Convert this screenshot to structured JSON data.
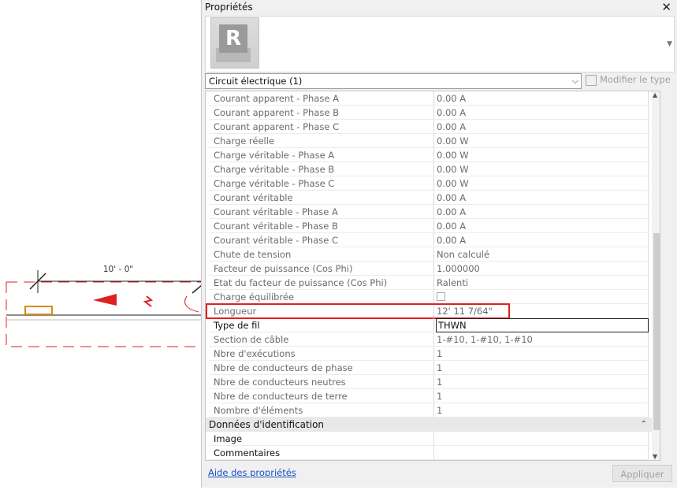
{
  "canvas": {
    "dimension_label": "10' - 0\""
  },
  "panel": {
    "title": "Propriétés",
    "close_glyph": "✕",
    "type_selector": {
      "value": "Circuit électrique (1)"
    },
    "modify_type_label": "Modifier le type",
    "rows": [
      {
        "name": "Courant apparent - Phase A",
        "value": "0.00 A"
      },
      {
        "name": "Courant apparent - Phase B",
        "value": "0.00 A"
      },
      {
        "name": "Courant apparent - Phase C",
        "value": "0.00 A"
      },
      {
        "name": "Charge réelle",
        "value": "0.00 W"
      },
      {
        "name": "Charge véritable - Phase A",
        "value": "0.00 W"
      },
      {
        "name": "Charge véritable - Phase B",
        "value": "0.00 W"
      },
      {
        "name": "Charge véritable - Phase C",
        "value": "0.00 W"
      },
      {
        "name": "Courant véritable",
        "value": "0.00 A"
      },
      {
        "name": "Courant véritable - Phase A",
        "value": "0.00 A"
      },
      {
        "name": "Courant véritable - Phase B",
        "value": "0.00 A"
      },
      {
        "name": "Courant véritable - Phase C",
        "value": "0.00 A"
      },
      {
        "name": "Chute de tension",
        "value": "Non calculé"
      },
      {
        "name": "Facteur de puissance (Cos Phi)",
        "value": "1.000000"
      },
      {
        "name": "Etat du facteur de puissance (Cos Phi)",
        "value": "Ralenti"
      },
      {
        "name": "Charge équilibrée",
        "value": ""
      },
      {
        "name": "Longueur",
        "value": "12'  11 7/64\""
      },
      {
        "name": "Type de fil",
        "value": "THWN"
      },
      {
        "name": "Section de câble",
        "value": "1-#10, 1-#10, 1-#10"
      },
      {
        "name": "Nbre d'exécutions",
        "value": "1"
      },
      {
        "name": "Nbre de conducteurs de phase",
        "value": "1"
      },
      {
        "name": "Nbre de conducteurs neutres",
        "value": "1"
      },
      {
        "name": "Nbre de conducteurs de terre",
        "value": "1"
      },
      {
        "name": "Nombre d'éléments",
        "value": "1"
      }
    ],
    "group_header": "Données d'identification",
    "identification_rows": [
      {
        "name": "Image",
        "value": ""
      },
      {
        "name": "Commentaires",
        "value": ""
      }
    ],
    "help_link": "Aide des propriétés",
    "apply_label": "Appliquer"
  },
  "colors": {
    "highlight": "#e02020",
    "annotation": "#e02020",
    "link": "#1a4fc4"
  }
}
